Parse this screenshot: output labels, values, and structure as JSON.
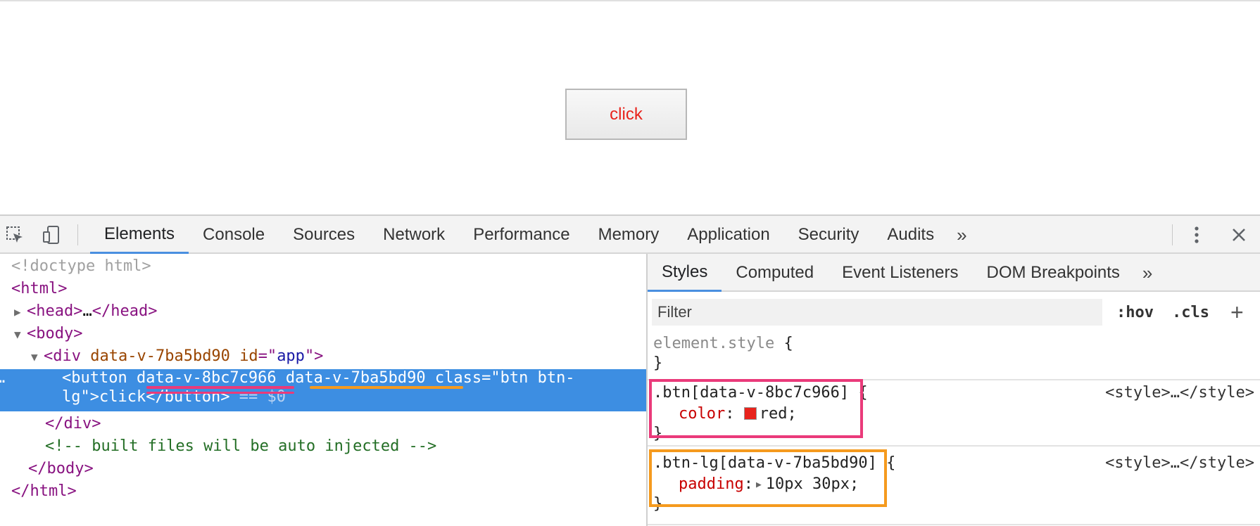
{
  "page": {
    "button_label": "click",
    "button_text_color": "#e8231c"
  },
  "devtools": {
    "tabs": [
      "Elements",
      "Console",
      "Sources",
      "Network",
      "Performance",
      "Memory",
      "Application",
      "Security",
      "Audits"
    ],
    "more_label": "»",
    "active_tab": "Elements",
    "accent_color": "#4a8fe0",
    "icons": {
      "inspect": "inspect-element-icon",
      "device": "device-toggle-icon",
      "kebab": "more-options-icon",
      "close": "close-icon"
    }
  },
  "elements": {
    "doctype": "<!doctype html>",
    "html_open": "html",
    "head": "head",
    "head_ellipsis": "…",
    "body_open": "body",
    "div_tag": "div",
    "div_attr_1": "data-v-7ba5bd90",
    "div_attr_id_name": "id",
    "div_attr_id_val": "app",
    "button_tag": "button",
    "button_attr_1": "data-v-8bc7c966",
    "button_attr_2": "data-v-7ba5bd90",
    "button_class_name": "class",
    "button_class_val_1": "btn btn-",
    "button_class_val_2": "lg",
    "button_text": "click",
    "button_close": "button",
    "selected_marker": "== $0",
    "selected_dots": "…",
    "div_close": "div",
    "comment": "<!-- built files will be auto injected -->",
    "body_close": "body",
    "html_close": "html",
    "selection_color": "#3d8ee2"
  },
  "styles": {
    "tabs": [
      "Styles",
      "Computed",
      "Event Listeners",
      "DOM Breakpoints"
    ],
    "more_label": "»",
    "active_tab": "Styles",
    "filter_placeholder": "Filter",
    "hov_label": ":hov",
    "cls_label": ".cls",
    "add_label": "+",
    "element_style_selector": "element.style",
    "open_brace": "{",
    "close_brace": "}",
    "rules": [
      {
        "selector": ".btn[data-v-8bc7c966]",
        "source": "<style>…</style>",
        "property": "color",
        "value": "red;",
        "swatch_color": "#e8231c",
        "highlight_color": "#ea3a7a"
      },
      {
        "selector": ".btn-lg[data-v-7ba5bd90]",
        "source": "<style>…</style>",
        "property": "padding",
        "value": "10px 30px;",
        "highlight_color": "#f59a1e"
      }
    ]
  }
}
